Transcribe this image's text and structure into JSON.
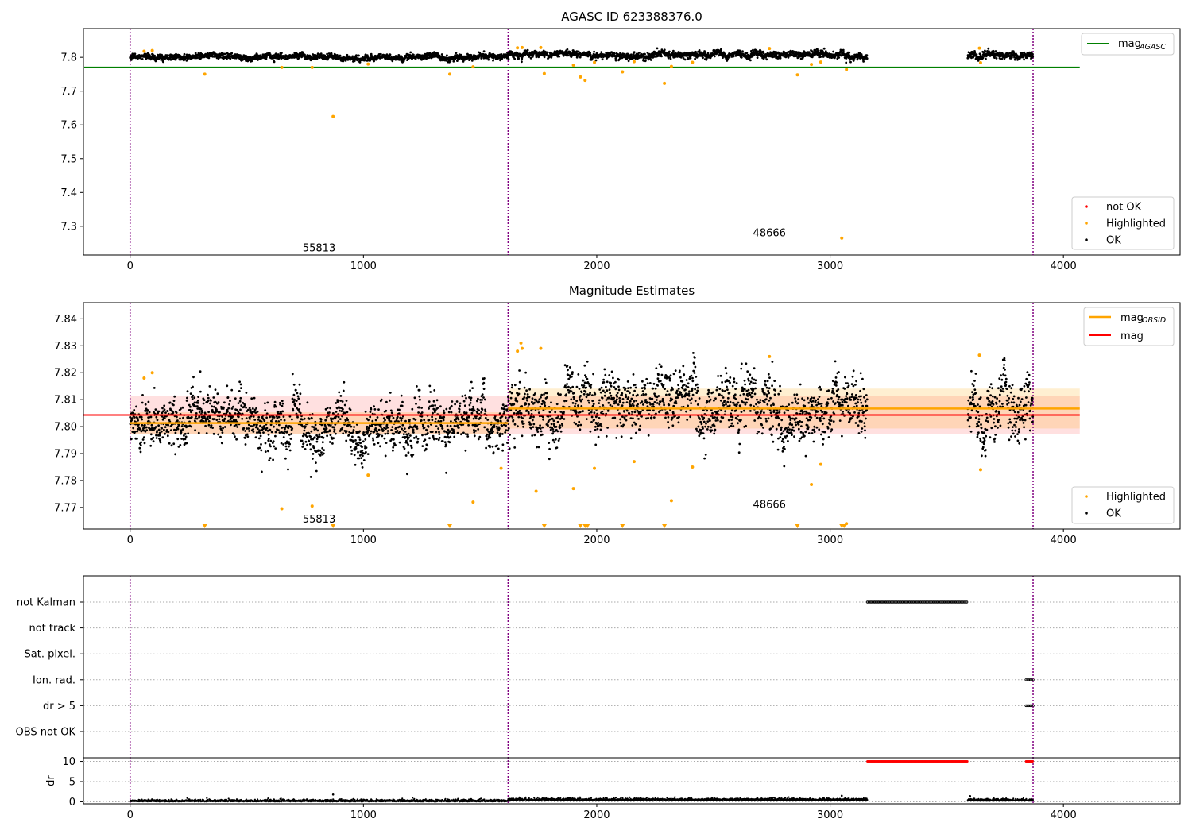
{
  "chart_data": [
    {
      "type": "scatter",
      "title": "AGASC ID 623388376.0",
      "xlim": [
        -200,
        4500
      ],
      "ylim": [
        7.215,
        7.885
      ],
      "xticks": [
        0,
        1000,
        2000,
        3000,
        4000
      ],
      "yticks": [
        7.3,
        7.4,
        7.5,
        7.6,
        7.7,
        7.8
      ],
      "ytick_labels": [
        "7.3",
        "7.4",
        "7.5",
        "7.6",
        "7.7",
        "7.8"
      ],
      "obs_boundaries": [
        0,
        1620,
        3870
      ],
      "obs_labels": [
        {
          "text": "55813",
          "x": 810,
          "y": 7.235
        },
        {
          "text": "48666",
          "x": 2740,
          "y": 7.28
        }
      ],
      "reference_line": {
        "name": "mag_AGASC",
        "y": 7.77,
        "x_range": [
          -200,
          4070
        ],
        "color": "#008000"
      },
      "series": [
        {
          "name": "OK",
          "color": "#000000",
          "segments": [
            {
              "x_range": [
                0,
                1620
              ],
              "mean": 7.801,
              "sd": 0.0055
            },
            {
              "x_range": [
                1620,
                3160
              ],
              "mean": 7.8065,
              "sd": 0.0065
            },
            {
              "x_range": [
                3590,
                3870
              ],
              "mean": 7.806,
              "sd": 0.0065
            }
          ]
        },
        {
          "name": "Highlighted",
          "color": "#ffa500",
          "points": [
            [
              60,
              7.818
            ],
            [
              95,
              7.82
            ],
            [
              320,
              7.75
            ],
            [
              650,
              7.77
            ],
            [
              780,
              7.77
            ],
            [
              870,
              7.625
            ],
            [
              1020,
              7.78
            ],
            [
              1370,
              7.75
            ],
            [
              1470,
              7.772
            ],
            [
              1660,
              7.828
            ],
            [
              1680,
              7.829
            ],
            [
              1760,
              7.829
            ],
            [
              1775,
              7.752
            ],
            [
              1900,
              7.777
            ],
            [
              1930,
              7.742
            ],
            [
              1950,
              7.732
            ],
            [
              1990,
              7.785
            ],
            [
              2110,
              7.757
            ],
            [
              2160,
              7.787
            ],
            [
              2290,
              7.723
            ],
            [
              2320,
              7.773
            ],
            [
              2410,
              7.785
            ],
            [
              2740,
              7.826
            ],
            [
              2860,
              7.748
            ],
            [
              2920,
              7.779
            ],
            [
              2960,
              7.786
            ],
            [
              3050,
              7.265
            ],
            [
              3070,
              7.764
            ],
            [
              3640,
              7.827
            ],
            [
              3645,
              7.784
            ]
          ]
        },
        {
          "name": "not OK",
          "color": "#ff0000",
          "points": []
        }
      ],
      "legends": [
        {
          "placement": "top-right",
          "items": [
            "mag_AGASC"
          ]
        },
        {
          "placement": "bottom-right",
          "items": [
            "not OK",
            "Highlighted",
            "OK"
          ]
        }
      ]
    },
    {
      "type": "scatter",
      "title": "Magnitude Estimates",
      "xlim": [
        -200,
        4500
      ],
      "ylim": [
        7.762,
        7.846
      ],
      "xticks": [
        0,
        1000,
        2000,
        3000,
        4000
      ],
      "yticks": [
        7.77,
        7.78,
        7.79,
        7.8,
        7.81,
        7.82,
        7.83,
        7.84
      ],
      "ytick_labels": [
        "7.77",
        "7.78",
        "7.79",
        "7.80",
        "7.81",
        "7.82",
        "7.83",
        "7.84"
      ],
      "obs_boundaries": [
        0,
        1620,
        3870
      ],
      "obs_labels": [
        {
          "text": "55813",
          "x": 810,
          "y": 7.7655
        },
        {
          "text": "48666",
          "x": 2740,
          "y": 7.771
        }
      ],
      "mag_line": {
        "name": "mag",
        "y": 7.8043,
        "band": [
          7.7972,
          7.8114
        ],
        "x_range": [
          0,
          4070
        ],
        "color": "#ff0000"
      },
      "obsid_lines": [
        {
          "x_range": [
            0,
            1620
          ],
          "y": 7.8013,
          "band": [
            7.7973,
            7.8053
          ]
        },
        {
          "x_range": [
            1620,
            4070
          ],
          "y": 7.8067,
          "band": [
            7.7993,
            7.8141
          ]
        }
      ],
      "series": [
        {
          "name": "OK",
          "color": "#000000",
          "segments": [
            {
              "x_range": [
                0,
                1620
              ],
              "mean": 7.801,
              "sd": 0.0055
            },
            {
              "x_range": [
                1620,
                3160
              ],
              "mean": 7.8065,
              "sd": 0.0065
            },
            {
              "x_range": [
                3590,
                3870
              ],
              "mean": 7.806,
              "sd": 0.0065
            }
          ]
        },
        {
          "name": "Highlighted",
          "color": "#ffa500",
          "points": [
            [
              60,
              7.818
            ],
            [
              95,
              7.82
            ],
            [
              650,
              7.7695
            ],
            [
              780,
              7.7705
            ],
            [
              1020,
              7.782
            ],
            [
              1470,
              7.772
            ],
            [
              1590,
              7.7845
            ],
            [
              1660,
              7.828
            ],
            [
              1675,
              7.831
            ],
            [
              1680,
              7.829
            ],
            [
              1760,
              7.829
            ],
            [
              1740,
              7.776
            ],
            [
              1900,
              7.777
            ],
            [
              1990,
              7.7845
            ],
            [
              2160,
              7.787
            ],
            [
              2320,
              7.7725
            ],
            [
              2410,
              7.785
            ],
            [
              2740,
              7.826
            ],
            [
              2920,
              7.7785
            ],
            [
              2960,
              7.786
            ],
            [
              3070,
              7.764
            ],
            [
              3640,
              7.8265
            ],
            [
              3645,
              7.784
            ]
          ],
          "below_axis_markers": [
            320,
            870,
            1370,
            1775,
            1930,
            1950,
            1960,
            2110,
            2290,
            2860,
            3050,
            3060
          ]
        }
      ],
      "legends": [
        {
          "placement": "top-right",
          "items": [
            "mag_OBSID",
            "mag"
          ]
        },
        {
          "placement": "bottom-right",
          "items": [
            "Highlighted",
            "OK"
          ]
        }
      ]
    },
    {
      "type": "scatter",
      "title": "",
      "xlim": [
        -200,
        4500
      ],
      "xticks": [
        0,
        1000,
        2000,
        3000,
        4000
      ],
      "obs_boundaries": [
        0,
        1620,
        3870
      ],
      "flag_rows": [
        {
          "label": "not Kalman",
          "ranges": [
            [
              3160,
              3590
            ]
          ]
        },
        {
          "label": "not track",
          "ranges": []
        },
        {
          "label": "Sat. pixel.",
          "ranges": []
        },
        {
          "label": "Ion. rad.",
          "ranges": [
            [
              3840,
              3870
            ]
          ]
        },
        {
          "label": "dr > 5",
          "ranges": [
            [
              3840,
              3870
            ]
          ]
        },
        {
          "label": "OBS not OK",
          "ranges": []
        }
      ],
      "dr_panel": {
        "ylabel": "dr",
        "ylim": [
          -0.5,
          10.5
        ],
        "yticks": [
          0,
          5,
          10
        ],
        "not_ok_ranges": [
          [
            3160,
            3590
          ],
          [
            3840,
            3870
          ]
        ],
        "not_ok_value": 10,
        "baseline_segments": [
          [
            0,
            1620,
            0.2
          ],
          [
            1620,
            3160,
            0.5
          ],
          [
            3590,
            3870,
            0.4
          ]
        ],
        "outliers": [
          [
            870,
            1.8
          ],
          [
            3050,
            1.5
          ],
          [
            3600,
            1.4
          ]
        ]
      }
    }
  ]
}
